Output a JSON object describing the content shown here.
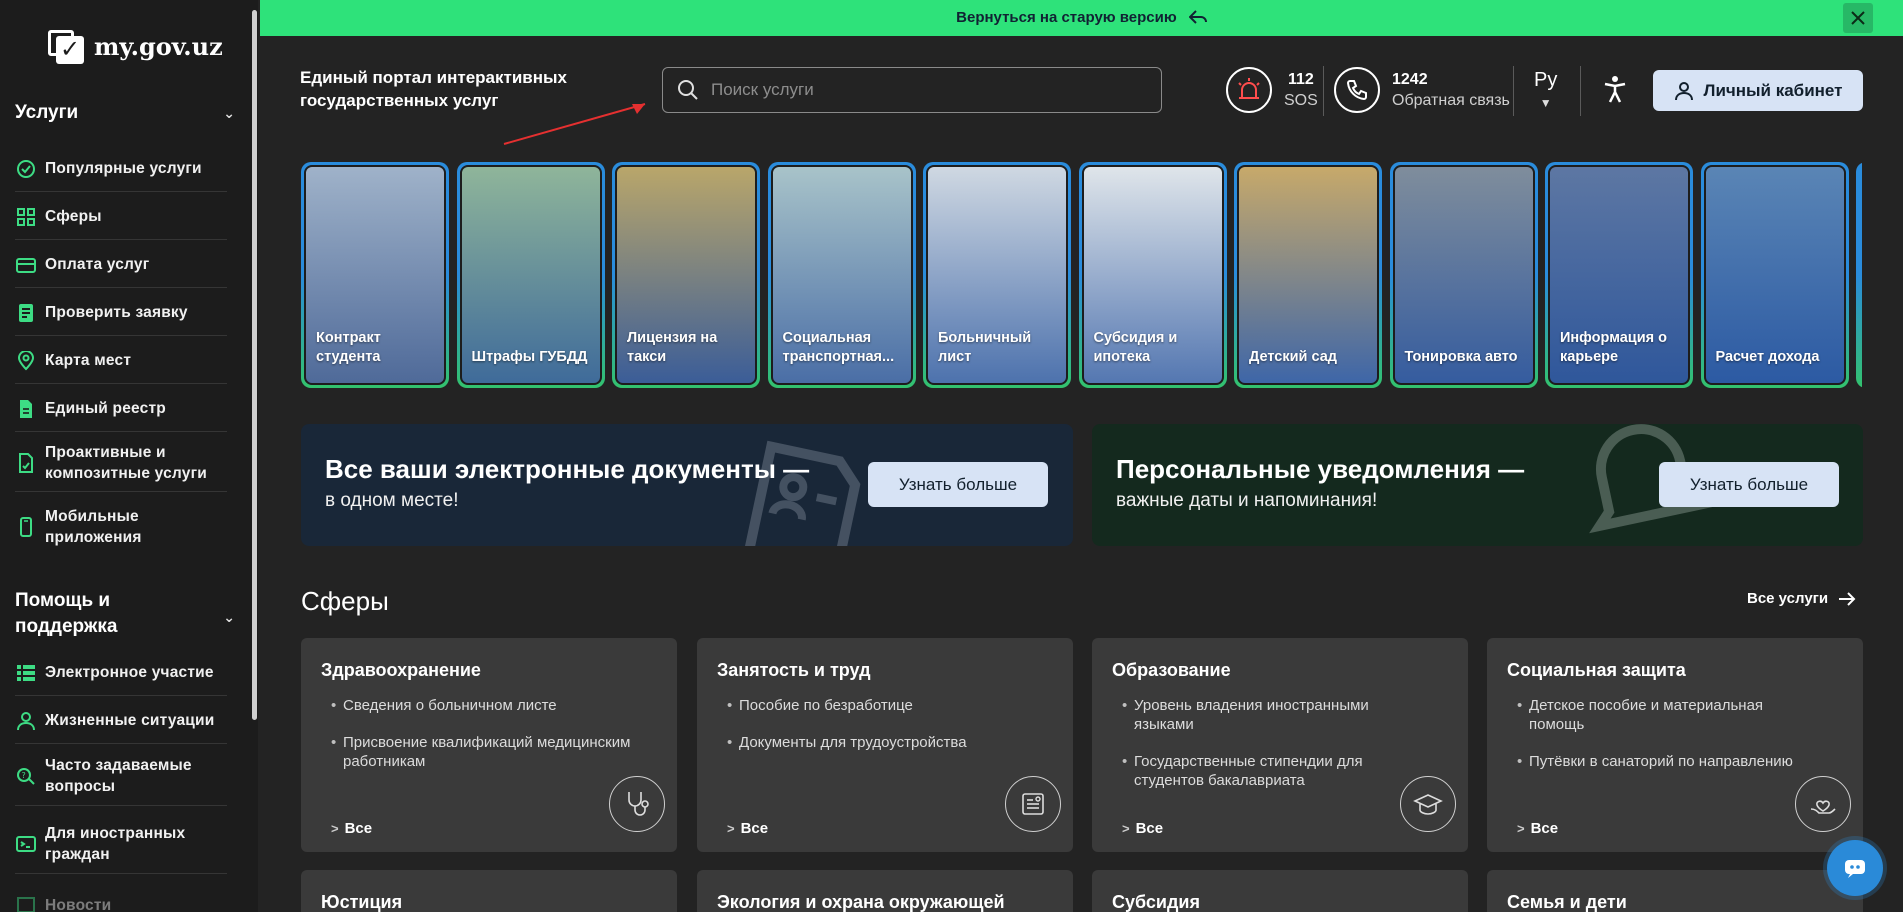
{
  "banner": {
    "text": "Вернуться на старую версию"
  },
  "logo": {
    "text": "my.gov.uz"
  },
  "sidebar": {
    "services_title": "Услуги",
    "services": [
      {
        "label": "Популярные услуги",
        "icon": "check-badge-icon"
      },
      {
        "label": "Сферы",
        "icon": "grid-icon"
      },
      {
        "label": "Оплата услуг",
        "icon": "card-icon"
      },
      {
        "label": "Проверить заявку",
        "icon": "checklist-icon"
      },
      {
        "label": "Карта мест",
        "icon": "map-pin-icon"
      },
      {
        "label": "Единый реестр",
        "icon": "document-icon"
      },
      {
        "label": "Проактивные и композитные услуги",
        "icon": "doc-edit-icon"
      },
      {
        "label": "Мобильные приложения",
        "icon": "phone-icon"
      }
    ],
    "help_title": "Помощь и поддержка",
    "help": [
      {
        "label": "Электронное участие",
        "icon": "list-icon"
      },
      {
        "label": "Жизненные ситуации",
        "icon": "user-icon"
      },
      {
        "label": "Часто задаваемые вопросы",
        "icon": "faq-icon"
      },
      {
        "label": "Для иностранных граждан",
        "icon": "terminal-icon"
      },
      {
        "label": "Новости",
        "icon": "news-icon"
      }
    ]
  },
  "header": {
    "portal_title_line1": "Единый портал интерактивных",
    "portal_title_line2": "государственных услуг",
    "search_placeholder": "Поиск услуги",
    "sos_number": "112",
    "sos_label": "SOS",
    "phone_number": "1242",
    "phone_label": "Обратная связь",
    "language": "Ру",
    "cabinet_label": "Личный кабинет"
  },
  "stories": [
    {
      "label": "Контракт студента",
      "c1": "#9fb2c9",
      "c2": "#4f6a99"
    },
    {
      "label": "Штрафы ГУБДД",
      "c1": "#8fb59a",
      "c2": "#3f6b9a"
    },
    {
      "label": "Лицензия на такси",
      "c1": "#b9a66a",
      "c2": "#3b5d98"
    },
    {
      "label": "Социальная транспортная...",
      "c1": "#a8c3c9",
      "c2": "#4a6ea6"
    },
    {
      "label": "Больничный лист",
      "c1": "#cfd8e2",
      "c2": "#4d72ad"
    },
    {
      "label": "Субсидия и ипотека",
      "c1": "#dfe5ea",
      "c2": "#5477b1"
    },
    {
      "label": "Детский сад",
      "c1": "#c7a96a",
      "c2": "#3e66a8"
    },
    {
      "label": "Тонировка авто",
      "c1": "#7f8d9c",
      "c2": "#355c9f"
    },
    {
      "label": "Информация о карьере",
      "c1": "#5d77a3",
      "c2": "#2f579b"
    },
    {
      "label": "Расчет дохода",
      "c1": "#5a85b5",
      "c2": "#2c5aa3"
    }
  ],
  "promos": [
    {
      "title": "Все ваши электронные документы —",
      "subtitle": "в одном месте!",
      "button": "Узнать больше"
    },
    {
      "title": "Персональные уведомления —",
      "subtitle": "важные даты и напоминания!",
      "button": "Узнать больше"
    }
  ],
  "spheres": {
    "title": "Сферы",
    "all_link": "Все услуги",
    "all_label": "Все",
    "cards": [
      {
        "title": "Здравоохранение",
        "items": [
          "Сведения о больничном листе",
          "Присвоение квалификаций медицинским работникам"
        ],
        "icon": "stethoscope-icon"
      },
      {
        "title": "Занятость и труд",
        "items": [
          "Пособие по безработице",
          "Документы для трудоустройства"
        ],
        "icon": "resume-icon"
      },
      {
        "title": "Образование",
        "items": [
          "Уровень владения иностранными языками",
          "Государственные стипендии для студентов бакалавриата"
        ],
        "icon": "graduation-cap-icon"
      },
      {
        "title": "Социальная защита",
        "items": [
          "Детское пособие и материальная помощь",
          "Путёвки в санаторий по направлению"
        ],
        "icon": "hand-heart-icon"
      }
    ],
    "next_cards": [
      "Юстиция",
      "Экология и охрана окружающей",
      "Субсидия",
      "Семья и дети"
    ]
  },
  "colors": {
    "banner": "#2ee27a",
    "accent_button": "#d7e3f5",
    "sidebar_icon": "#3ddc84",
    "chat": "#2a8ad8"
  }
}
